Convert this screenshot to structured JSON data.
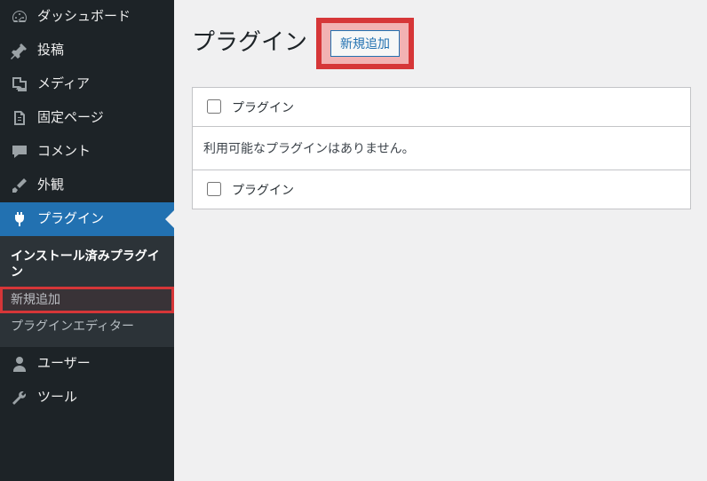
{
  "sidebar": {
    "items": [
      {
        "label": "ダッシュボード",
        "icon": "dashboard"
      },
      {
        "label": "投稿",
        "icon": "post"
      },
      {
        "label": "メディア",
        "icon": "media"
      },
      {
        "label": "固定ページ",
        "icon": "page"
      },
      {
        "label": "コメント",
        "icon": "comment"
      },
      {
        "label": "外観",
        "icon": "appearance"
      },
      {
        "label": "プラグイン",
        "icon": "plugin",
        "current": true,
        "submenu": [
          {
            "label": "インストール済みプラグイン",
            "current": true
          },
          {
            "label": "新規追加",
            "highlight": true
          },
          {
            "label": "プラグインエディター"
          }
        ]
      },
      {
        "label": "ユーザー",
        "icon": "user"
      },
      {
        "label": "ツール",
        "icon": "tool"
      }
    ]
  },
  "page": {
    "title": "プラグイン",
    "add_new_label": "新規追加"
  },
  "table": {
    "column_plugin": "プラグイン",
    "no_items": "利用可能なプラグインはありません。"
  }
}
